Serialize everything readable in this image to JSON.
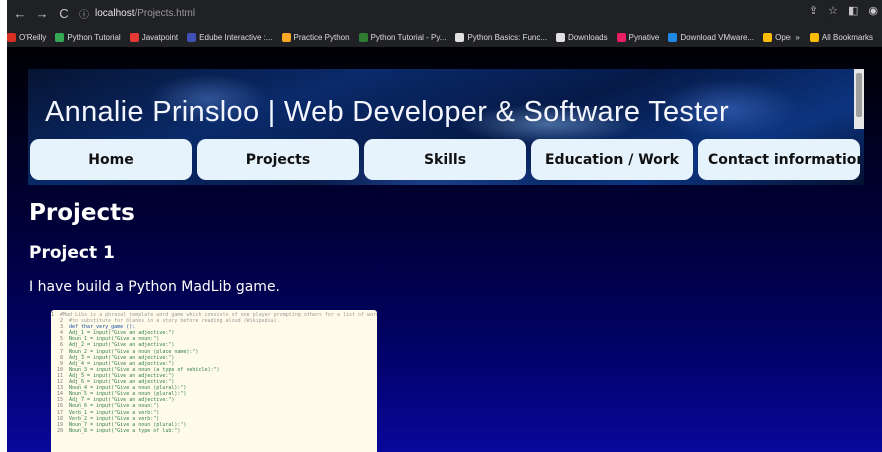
{
  "browser": {
    "url_host": "localhost",
    "url_path": "/Projects.html",
    "bookmarks": [
      {
        "label": "O'Reilly",
        "color": "#d93025"
      },
      {
        "label": "Python Tutorial",
        "color": "#34a853"
      },
      {
        "label": "Javatpoint",
        "color": "#e53935"
      },
      {
        "label": "Edube Interactive :...",
        "color": "#3f51b5"
      },
      {
        "label": "Practice Python",
        "color": "#f9a825"
      },
      {
        "label": "Python Tutorial - Py...",
        "color": "#2e7d32"
      },
      {
        "label": "Python Basics: Func...",
        "color": "#e0e0e0"
      },
      {
        "label": "Downloads",
        "color": "#e0e0e0"
      },
      {
        "label": "Pynative",
        "color": "#e91e63"
      },
      {
        "label": "Download VMware...",
        "color": "#1e88e5"
      },
      {
        "label": "Operating Systems",
        "color": "#fbbc04"
      }
    ],
    "bookmarks_overflow": "»",
    "all_bookmarks": "All Bookmarks"
  },
  "site": {
    "title": "Annalie Prinsloo | Web Developer & Software Tester",
    "nav": [
      "Home",
      "Projects",
      "Skills",
      "Education / Work",
      "Contact information"
    ]
  },
  "content": {
    "heading": "Projects",
    "project_title": "Project 1",
    "project_desc": "I have build a Python MadLib game."
  },
  "code_lines": [
    {
      "n": "1",
      "t": "#Mad Libs is a phrasal template word game which consists of one player prompting others for a list of words",
      "k": "comment"
    },
    {
      "n": "2",
      "t": "#to substitute for blanks in a story before reading aloud (Wikipedia).",
      "k": "comment"
    },
    {
      "n": "3",
      "t": "def thar_very_game ():",
      "k": "kw"
    },
    {
      "n": "4",
      "t": "    Adj_1 = input(\"Give an adjective:\")",
      "k": "code"
    },
    {
      "n": "5",
      "t": "    Noun_1 = input(\"Give a noun:\")",
      "k": "code"
    },
    {
      "n": "6",
      "t": "    Adj_2 = input(\"Give an adjective:\")",
      "k": "code"
    },
    {
      "n": "7",
      "t": "    Noun_2 = input(\"Give a noun (place name):\")",
      "k": "code"
    },
    {
      "n": "8",
      "t": "    Adj_3 = input(\"Give an adjective:\")",
      "k": "code"
    },
    {
      "n": "9",
      "t": "    Adj_4 = input(\"Give an adjective:\")",
      "k": "code"
    },
    {
      "n": "10",
      "t": "    Noun_3 = input(\"Give a noun (a type of vehicle):\")",
      "k": "code"
    },
    {
      "n": "11",
      "t": "    Adj_5 = input(\"Give an adjective:\")",
      "k": "code"
    },
    {
      "n": "12",
      "t": "    Adj_6 = input(\"Give an adjective:\")",
      "k": "code"
    },
    {
      "n": "13",
      "t": "    Noun_4 = input(\"Give a noun (plural):\")",
      "k": "code"
    },
    {
      "n": "14",
      "t": "    Noun_5 = input(\"Give a noun (plural):\")",
      "k": "code"
    },
    {
      "n": "15",
      "t": "    Adj_7 = input(\"Give an adjective:\")",
      "k": "code"
    },
    {
      "n": "16",
      "t": "    Noun_6 = input(\"Give a noun:\")",
      "k": "code"
    },
    {
      "n": "17",
      "t": "    Verb_1 = input(\"Give a verb:\")",
      "k": "code"
    },
    {
      "n": "18",
      "t": "    Verb_2 = input(\"Give a verb:\")",
      "k": "code"
    },
    {
      "n": "19",
      "t": "    Noun_7 = input(\"Give a noun (plural):\")",
      "k": "code"
    },
    {
      "n": "20",
      "t": "    Noun_8 = input(\"Give a type of lub:\")",
      "k": "code"
    }
  ]
}
